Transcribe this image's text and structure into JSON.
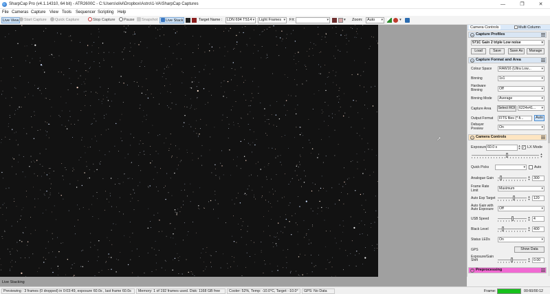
{
  "window": {
    "title": "SharpCap Pro (v4.1.14310, 64 bit) - ATR2600C - C:\\Users\\olivi\\Dropbox\\Astro\\1-VA\\SharpCap Captures",
    "minimize_glyph": "—",
    "maximize_glyph": "❐",
    "close_glyph": "✕"
  },
  "menu": [
    "File",
    "Cameras",
    "Capture",
    "View",
    "Tools",
    "Sequencer",
    "Scripting",
    "Help"
  ],
  "toolbar": {
    "live_view": "Live View",
    "start_capture": "Start Capture",
    "quick_capture": "Quick Capture",
    "stop_capture": "Stop Capture",
    "pause": "Pause",
    "snapshot": "Snapshot",
    "live_stack": "Live Stack",
    "target_name_label": "Target Name :",
    "target_name_value": "LDN 694 TS14",
    "frame_type": "Light Frames",
    "fx_label": "FX",
    "zoom_label": "Zoom:",
    "zoom_value": "Auto"
  },
  "panel": {
    "tabs": [
      "Camera Controls",
      "Multi Column"
    ],
    "profiles": {
      "title": "Capture Profiles",
      "selected": "571C Gain 2 triple Low noise",
      "buttons": [
        "Load",
        "Save",
        "Save As",
        "Manage"
      ]
    },
    "format": {
      "title": "Capture Format and Area",
      "colour_space_label": "Colour Space",
      "colour_space": "RAW16 (Ultra Low...",
      "binning_label": "Binning",
      "binning": "1x1",
      "hw_binning_label": "Hardware Binning",
      "hw_binning": "Off",
      "binning_mode_label": "Binning Mode",
      "binning_mode": "Average",
      "capture_area_label": "Capture Area",
      "select_roi": "Select ROI",
      "capture_area": "6224x41...",
      "output_format_label": "Output Format",
      "output_format": "FITS files (*.fi...",
      "auto_label": "Auto",
      "debayer_label": "Debayer Preview",
      "debayer": "On"
    },
    "camera": {
      "title": "Camera Controls",
      "exposure_label": "Exposure",
      "exposure_value": "60.0 s",
      "lx_mode_label": "LX Mode",
      "quick_picks_label": "Quick Picks",
      "quick_auto_label": "Auto",
      "analogue_gain_label": "Analogue Gain",
      "analogue_gain_value": "300",
      "frame_rate_label": "Frame Rate Limit",
      "frame_rate_value": "Maximum",
      "auto_exp_label": "Auto Exp Target",
      "auto_exp_value": "120",
      "auto_gain_label": "Auto Gain with Auto Exposure",
      "auto_gain_value": "Off",
      "usb_label": "USB Speed",
      "usb_value": "4",
      "black_label": "Black Level",
      "black_value": "400",
      "status_leds_label": "Status LEDs",
      "status_leds_value": "On",
      "gps_label": "GPS",
      "show_data": "Show Data",
      "exp_gain_shift_label": "Exposure/Gain Shift",
      "exp_gain_shift_value": "0.00"
    },
    "preprocessing_title": "Preprocessing"
  },
  "live_stacking_label": "Live Stacking",
  "status": {
    "previewing": "Previewing : 3 frames (0 dropped) in 0:03:49, exposure 60.0s , last frame 60.0s",
    "memory": "Memory: 1 of 192 frames used. Disk: 1168 GB free",
    "cooler": "Cooler: 52%, Temp: -10.0°C, Target: -10.0°",
    "gps": "GPS: No Data",
    "frame_label": "Frame:",
    "frame_progress": 1.0,
    "timer": "00:60/00:12"
  },
  "colors": {
    "image_bg": "#121212",
    "frame_fill": "#17c11c",
    "preprocessing": "#f06ad2",
    "camera_controls_header": "#fde5c2"
  }
}
